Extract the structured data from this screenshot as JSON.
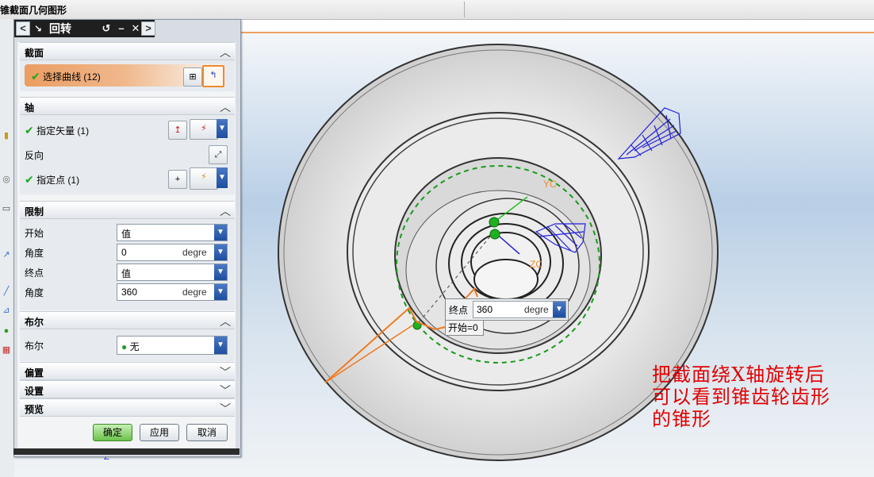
{
  "window": {
    "title": "锥截面几何图形"
  },
  "dialog": {
    "title": "回转",
    "sections": {
      "section": {
        "label": "截面",
        "select_curve": "选择曲线 (12)"
      },
      "axis": {
        "label": "轴",
        "specify_vector": "指定矢量 (1)",
        "reverse": "反向",
        "specify_point": "指定点 (1)"
      },
      "limits": {
        "label": "限制",
        "start_label": "开始",
        "start_value": "值",
        "start_angle_label": "角度",
        "start_angle": "0",
        "start_unit": "degre",
        "end_label": "终点",
        "end_value": "值",
        "end_angle_label": "角度",
        "end_angle": "360",
        "end_unit": "degre"
      },
      "boolean": {
        "label": "布尔",
        "field_label": "布尔",
        "value": "无"
      },
      "offset": {
        "label": "偏置"
      },
      "settings": {
        "label": "设置"
      },
      "preview": {
        "label": "预览"
      }
    },
    "buttons": {
      "ok": "确定",
      "apply": "应用",
      "cancel": "取消"
    }
  },
  "viewport": {
    "float_end_label": "终点",
    "float_end_value": "360",
    "float_end_unit": "degre",
    "float_start_text": "开始=0",
    "yc_label": "YC",
    "zc_label": "ZC",
    "z_label": "Z",
    "annotation_lines": [
      "把截面绕X轴旋转后",
      "可以看到锥齿轮齿形",
      "的锥形"
    ]
  },
  "colors": {
    "accent_orange": "#f08a2c",
    "annotation_red": "#e20000",
    "check_green": "#1aa81a"
  }
}
